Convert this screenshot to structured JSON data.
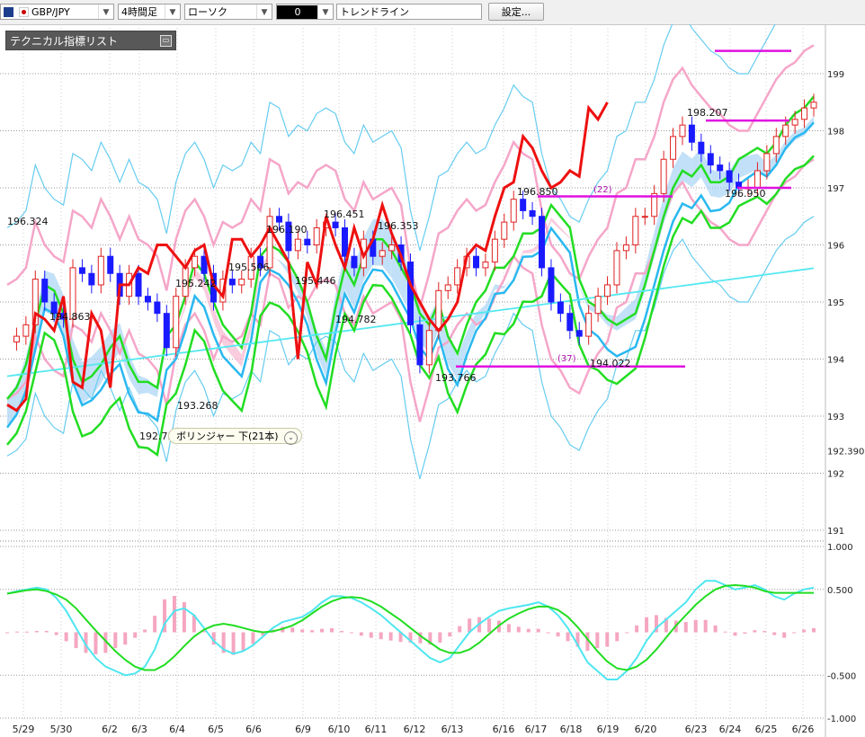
{
  "toolbar": {
    "symbol": "GBP/JPY",
    "symbol_icon": "flag-icon",
    "timeframe": "4時間足",
    "chart_style": "ローソク",
    "color_chip": "0",
    "tool": "トレンドライン",
    "settings_label": "設定..."
  },
  "indicator_panel": {
    "title": "テクニカル指標リスト",
    "toggle_icon": "window-icon"
  },
  "tooltip": {
    "label": "ボリンジャー 下(21本)",
    "icon": "chevron-down-icon"
  },
  "colors": {
    "up_candle": "#e02020",
    "down_candle": "#1a1aff",
    "price_line": "#ee1010",
    "ma_green": "#22dd22",
    "ma_cyan": "#2ab8f0",
    "ma_lightcyan": "#55e8f0",
    "bb_pink": "#f5a6c9",
    "bb_cyan": "#66ccf0",
    "kumo_blue": "#a8d4f5",
    "kumo_pink": "#f7b6d0",
    "hline": "#e010e0"
  },
  "chart_data": [
    {
      "type": "line",
      "ylim": [
        190.75,
        199.65
      ],
      "y_ticks": [
        "199",
        "198",
        "197",
        "196",
        "195",
        "194",
        "193",
        "192",
        "191"
      ],
      "current_price_label": "192.390",
      "x_labels": [
        "5/29",
        "5/30",
        "6/2",
        "6/3",
        "6/4",
        "6/5",
        "6/6",
        "6/9",
        "6/10",
        "6/11",
        "6/12",
        "6/13",
        "6/16",
        "6/17",
        "6/18",
        "6/19",
        "6/20",
        "6/23",
        "6/24",
        "6/25",
        "6/26"
      ],
      "annotations": {
        "price_labels": [
          "196.324",
          "194.863",
          "195.242",
          "192.73",
          "193.268",
          "196.190",
          "195.506",
          "195.446",
          "196.451",
          "194.782",
          "196.353",
          "193.766",
          "196.850",
          "194.022",
          "198.207",
          "196.950"
        ],
        "bar_counts": [
          "(22)",
          "(37)"
        ]
      },
      "series": [
        {
          "values": [
            193.3,
            193.5,
            193.9,
            194.6,
            195.3,
            195.2,
            194.8,
            194.0,
            193.6,
            193.7,
            193.9,
            194.2,
            194.4,
            193.9,
            193.6,
            193.6,
            193.5,
            194.4,
            194.6,
            195.1,
            195.7,
            195.5,
            195.0,
            194.6,
            194.4,
            194.2,
            194.8,
            195.8,
            196.0,
            195.9,
            195.7,
            195.4,
            195.0,
            194.4,
            194.0,
            194.9,
            195.6,
            195.3,
            195.8,
            196.1,
            196.1,
            195.9,
            195.6,
            195.3,
            194.8,
            194.6,
            195.0,
            194.4,
            194.1,
            194.6,
            195.0,
            195.2,
            195.6,
            195.6,
            195.8,
            196.2,
            196.2,
            196.3,
            196.7,
            196.5,
            196.3,
            195.4,
            195.0,
            194.9,
            194.7,
            194.6,
            194.7,
            194.8,
            195.3,
            195.9,
            196.5,
            197.0,
            197.3,
            197.2,
            197.4,
            197.1,
            197.1,
            197.2,
            197.5,
            197.6,
            197.7,
            197.6,
            197.8,
            198.1,
            198.3,
            198.4,
            198.6
          ]
        },
        {
          "values": [
            194.3,
            194.4,
            194.6,
            195.4,
            195.0,
            194.8,
            194.7,
            195.6,
            195.5,
            195.3,
            195.8,
            195.5,
            195.1,
            195.5,
            195.1,
            195.0,
            194.8,
            194.2,
            195.1,
            195.6,
            195.8,
            195.5,
            195.0,
            195.4,
            195.3,
            195.4,
            195.8,
            195.6,
            196.5,
            196.4,
            195.9,
            196.1,
            196.0,
            196.3,
            196.4,
            196.3,
            195.8,
            195.6,
            196.1,
            195.8,
            195.9,
            196.0,
            195.7,
            194.6,
            193.9,
            194.5,
            195.2,
            195.3,
            195.6,
            195.8,
            195.6,
            195.7,
            196.1,
            196.4,
            196.8,
            196.6,
            196.5,
            195.6,
            195.0,
            194.8,
            194.5,
            194.4,
            194.8,
            195.1,
            195.3,
            195.9,
            196.0,
            196.5,
            196.5,
            196.9,
            197.5,
            197.9,
            198.1,
            197.8,
            197.6,
            197.4,
            197.3,
            197.1,
            197.0,
            197.0,
            197.3,
            197.6,
            197.9,
            198.1,
            198.2,
            198.4,
            198.5
          ]
        },
        {
          "values": [
            193.2,
            193.1,
            193.3,
            194.8,
            194.7,
            194.5,
            195.1,
            193.6,
            193.5,
            194.8,
            194.5,
            193.5,
            195.3,
            195.3,
            195.6,
            195.5,
            196.0,
            196.0,
            195.8,
            195.6,
            195.9,
            196.0,
            195.3,
            195.1,
            196.1,
            196.1,
            195.8,
            196.0,
            196.3,
            196.0,
            195.7,
            194.0,
            195.7,
            195.3,
            196.5,
            196.0,
            195.6,
            196.3,
            195.8,
            196.1,
            196.7,
            196.2,
            195.8,
            195.3,
            195.0,
            194.7,
            194.5,
            194.7,
            195.0,
            195.8,
            196.0,
            195.9,
            196.5,
            197.0,
            197.1,
            197.9,
            197.7,
            197.3,
            197.0,
            197.1,
            197.3,
            197.2,
            198.4,
            198.2,
            198.5,
            null,
            null,
            null,
            null,
            null,
            null,
            null,
            null,
            null,
            null,
            null,
            null,
            null,
            null,
            null,
            null,
            null,
            null,
            null,
            null,
            null,
            null
          ]
        }
      ]
    },
    {
      "type": "line",
      "ylim": [
        -1.0,
        1.0
      ],
      "y_ticks": [
        "1.000",
        "0.500",
        "-0.500",
        "-1.000"
      ],
      "series": [
        {
          "values": [
            0.45,
            0.48,
            0.5,
            0.52,
            0.5,
            0.4,
            0.25,
            0.05,
            -0.15,
            -0.3,
            -0.4,
            -0.45,
            -0.5,
            -0.48,
            -0.4,
            -0.2,
            0.1,
            0.25,
            0.28,
            0.2,
            0.05,
            -0.1,
            -0.2,
            -0.25,
            -0.22,
            -0.15,
            -0.05,
            0.05,
            0.12,
            0.15,
            0.18,
            0.25,
            0.35,
            0.42,
            0.42,
            0.4,
            0.35,
            0.28,
            0.2,
            0.1,
            0.0,
            -0.1,
            -0.2,
            -0.3,
            -0.35,
            -0.3,
            -0.15,
            0.0,
            0.1,
            0.18,
            0.25,
            0.28,
            0.3,
            0.32,
            0.35,
            0.3,
            0.2,
            0.05,
            -0.15,
            -0.35,
            -0.45,
            -0.55,
            -0.55,
            -0.45,
            -0.3,
            -0.1,
            0.05,
            0.15,
            0.25,
            0.35,
            0.5,
            0.6,
            0.6,
            0.55,
            0.5,
            0.52,
            0.55,
            0.5,
            0.42,
            0.38,
            0.45,
            0.5,
            0.52
          ]
        },
        {
          "values": [
            0.45,
            0.47,
            0.49,
            0.5,
            0.48,
            0.44,
            0.38,
            0.28,
            0.15,
            0.02,
            -0.1,
            -0.22,
            -0.32,
            -0.4,
            -0.44,
            -0.44,
            -0.38,
            -0.28,
            -0.16,
            -0.05,
            0.03,
            0.08,
            0.1,
            0.08,
            0.05,
            0.02,
            0.0,
            0.01,
            0.04,
            0.08,
            0.14,
            0.22,
            0.3,
            0.36,
            0.4,
            0.41,
            0.4,
            0.36,
            0.3,
            0.22,
            0.14,
            0.05,
            -0.04,
            -0.12,
            -0.2,
            -0.24,
            -0.24,
            -0.2,
            -0.12,
            -0.02,
            0.08,
            0.16,
            0.22,
            0.27,
            0.3,
            0.3,
            0.26,
            0.18,
            0.06,
            -0.08,
            -0.22,
            -0.34,
            -0.42,
            -0.44,
            -0.4,
            -0.32,
            -0.2,
            -0.06,
            0.08,
            0.2,
            0.32,
            0.42,
            0.5,
            0.54,
            0.55,
            0.54,
            0.52,
            0.48,
            0.46,
            0.46,
            0.46,
            0.46,
            0.46
          ]
        }
      ]
    }
  ]
}
